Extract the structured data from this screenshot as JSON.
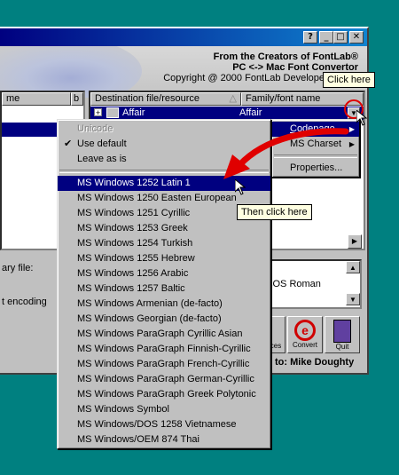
{
  "window": {
    "banner_line1": "From the Creators of FontLab®",
    "banner_line2": "PC <-> Mac Font Convertor",
    "banner_line3": "Copyright @ 2000 FontLab Develope",
    "dedication": "to: Mike Doughty"
  },
  "title_buttons": {
    "help": "?",
    "minimize": "_",
    "maximize": "□",
    "close": "✕"
  },
  "left_table": {
    "col_name": "me",
    "col_b": "b"
  },
  "right_table": {
    "col_dest": "Destination file/resource",
    "col_family": "Family/font name",
    "row_name": "Affair",
    "row_family": "Affair"
  },
  "context_menu": {
    "items": [
      "Codepage",
      "MS Charset",
      "Properties..."
    ]
  },
  "left_labels": {
    "primary": "ary file:",
    "encoding": "t encoding"
  },
  "right_panel": {
    "mac_text": "cOS Roman"
  },
  "toolbar": {
    "convert": "Convert",
    "quit": "Quit",
    "partial": "ces"
  },
  "dropdown": {
    "top_items": [
      "Unicode",
      "Use default",
      "Leave as is"
    ],
    "items": [
      "MS Windows 1252 Latin 1",
      "MS Windows 1250 Easten European",
      "MS Windows 1251 Cyrillic",
      "MS Windows 1253 Greek",
      "MS Windows 1254 Turkish",
      "MS Windows 1255 Hebrew",
      "MS Windows 1256 Arabic",
      "MS Windows 1257 Baltic",
      "MS Windows Armenian (de-facto)",
      "MS Windows Georgian (de-facto)",
      "MS Windows ParaGraph Cyrillic Asian",
      "MS Windows ParaGraph Finnish-Cyrillic",
      "MS Windows ParaGraph French-Cyrillic",
      "MS Windows ParaGraph German-Cyrillic",
      "MS Windows ParaGraph Greek Polytonic",
      "MS Windows Symbol",
      "MS Windows/DOS 1258 Vietnamese",
      "MS Windows/OEM 874 Thai"
    ]
  },
  "tooltips": {
    "click_here": "Click here",
    "then_click": "Then click here"
  },
  "colors": {
    "desktop": "#008080",
    "selection": "#000080",
    "arrow": "#e00000",
    "tooltip_bg": "#ffffe1"
  }
}
